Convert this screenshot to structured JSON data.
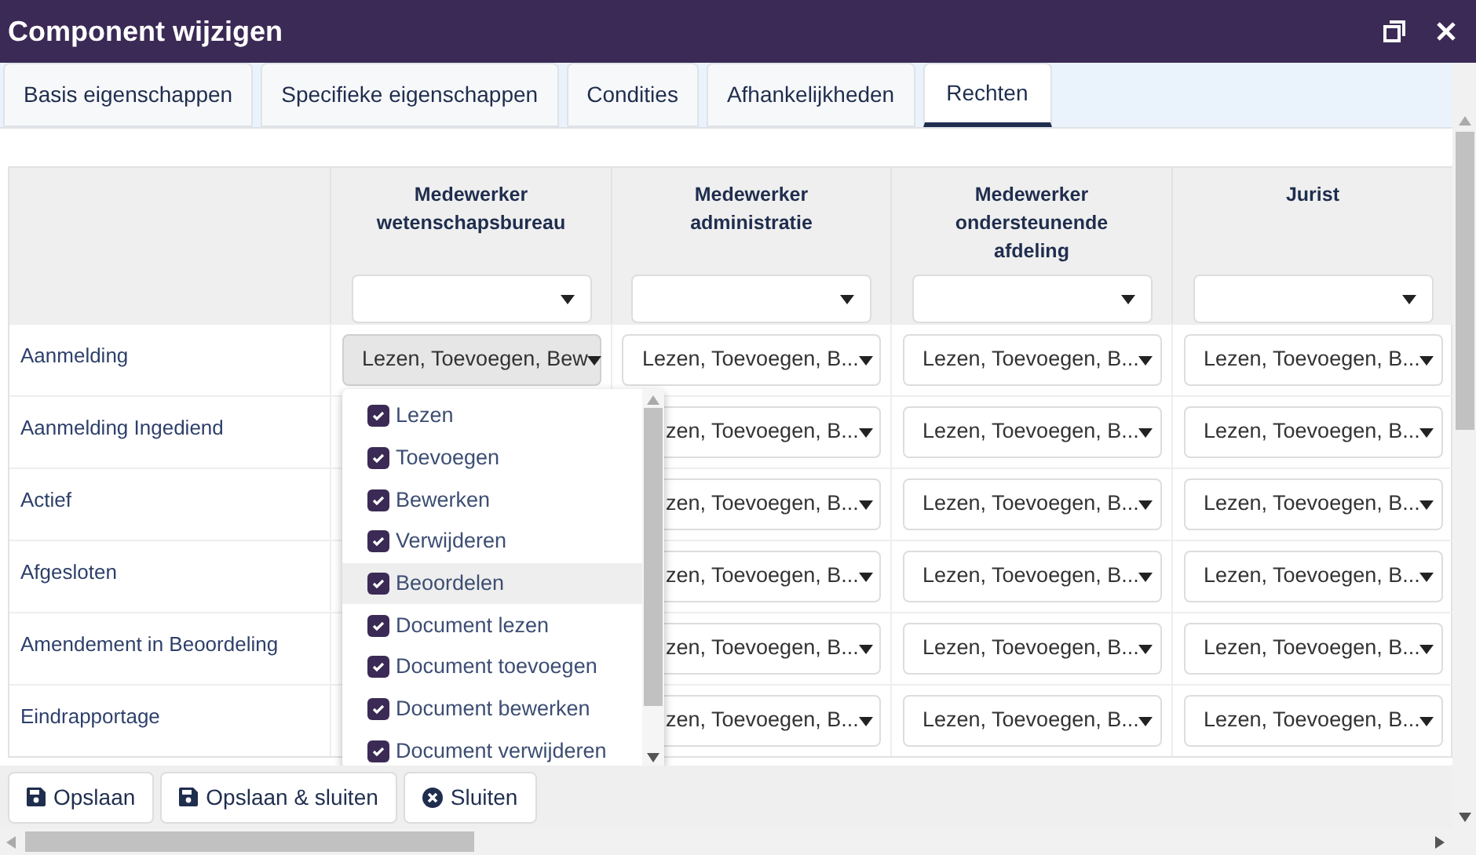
{
  "window": {
    "title": "Component wijzigen"
  },
  "tabs": [
    {
      "label": "Basis eigenschappen",
      "selected": false
    },
    {
      "label": "Specifieke eigenschappen",
      "selected": false
    },
    {
      "label": "Condities",
      "selected": false
    },
    {
      "label": "Afhankelijkheden",
      "selected": false
    },
    {
      "label": "Rechten",
      "selected": true
    }
  ],
  "table": {
    "columns": [
      "Medewerker wetenschapsbureau",
      "Medewerker administratie",
      "Medewerker ondersteunende afdeling",
      "Jurist"
    ],
    "rows": [
      {
        "label": "Aanmelding",
        "under_menu": false,
        "cells": [
          {
            "value": "Lezen, Toevoegen, Bew",
            "open": true
          },
          {
            "value": "Lezen, Toevoegen, B..."
          },
          {
            "value": "Lezen, Toevoegen, B..."
          },
          {
            "value": "Lezen, Toevoegen, B..."
          }
        ]
      },
      {
        "label": "Aanmelding Ingediend",
        "under_menu": true,
        "cells": [
          {
            "value": "zen, Toevoegen, B..."
          },
          {
            "value": "Lezen, Toevoegen, B..."
          },
          {
            "value": "Lezen, Toevoegen, B..."
          }
        ]
      },
      {
        "label": "Actief",
        "under_menu": true,
        "cells": [
          {
            "value": "zen, Toevoegen, B..."
          },
          {
            "value": "Lezen, Toevoegen, B..."
          },
          {
            "value": "Lezen, Toevoegen, B..."
          }
        ]
      },
      {
        "label": "Afgesloten",
        "under_menu": true,
        "cells": [
          {
            "value": "zen, Toevoegen, B..."
          },
          {
            "value": "Lezen, Toevoegen, B..."
          },
          {
            "value": "Lezen, Toevoegen, B..."
          }
        ]
      },
      {
        "label": "Amendement in Beoordeling",
        "under_menu": true,
        "cells": [
          {
            "value": "zen, Toevoegen, B..."
          },
          {
            "value": "Lezen, Toevoegen, B..."
          },
          {
            "value": "Lezen, Toevoegen, B..."
          }
        ]
      },
      {
        "label": "Eindrapportage",
        "under_menu": true,
        "cells": [
          {
            "value": "zen, Toevoegen, B..."
          },
          {
            "value": "Lezen, Toevoegen, B..."
          },
          {
            "value": "Lezen, Toevoegen, B..."
          }
        ]
      }
    ]
  },
  "dropdown": {
    "options": [
      {
        "label": "Lezen",
        "checked": true,
        "highlighted": false
      },
      {
        "label": "Toevoegen",
        "checked": true,
        "highlighted": false
      },
      {
        "label": "Bewerken",
        "checked": true,
        "highlighted": false
      },
      {
        "label": "Verwijderen",
        "checked": true,
        "highlighted": false
      },
      {
        "label": "Beoordelen",
        "checked": true,
        "highlighted": true
      },
      {
        "label": "Document lezen",
        "checked": true,
        "highlighted": false
      },
      {
        "label": "Document toevoegen",
        "checked": true,
        "highlighted": false
      },
      {
        "label": "Document bewerken",
        "checked": true,
        "highlighted": false
      },
      {
        "label": "Document verwijderen",
        "checked": true,
        "highlighted": false
      }
    ]
  },
  "buttons": [
    {
      "label": "Opslaan",
      "kind": "save"
    },
    {
      "label": "Opslaan & sluiten",
      "kind": "save"
    },
    {
      "label": "Sluiten",
      "kind": "close"
    }
  ]
}
